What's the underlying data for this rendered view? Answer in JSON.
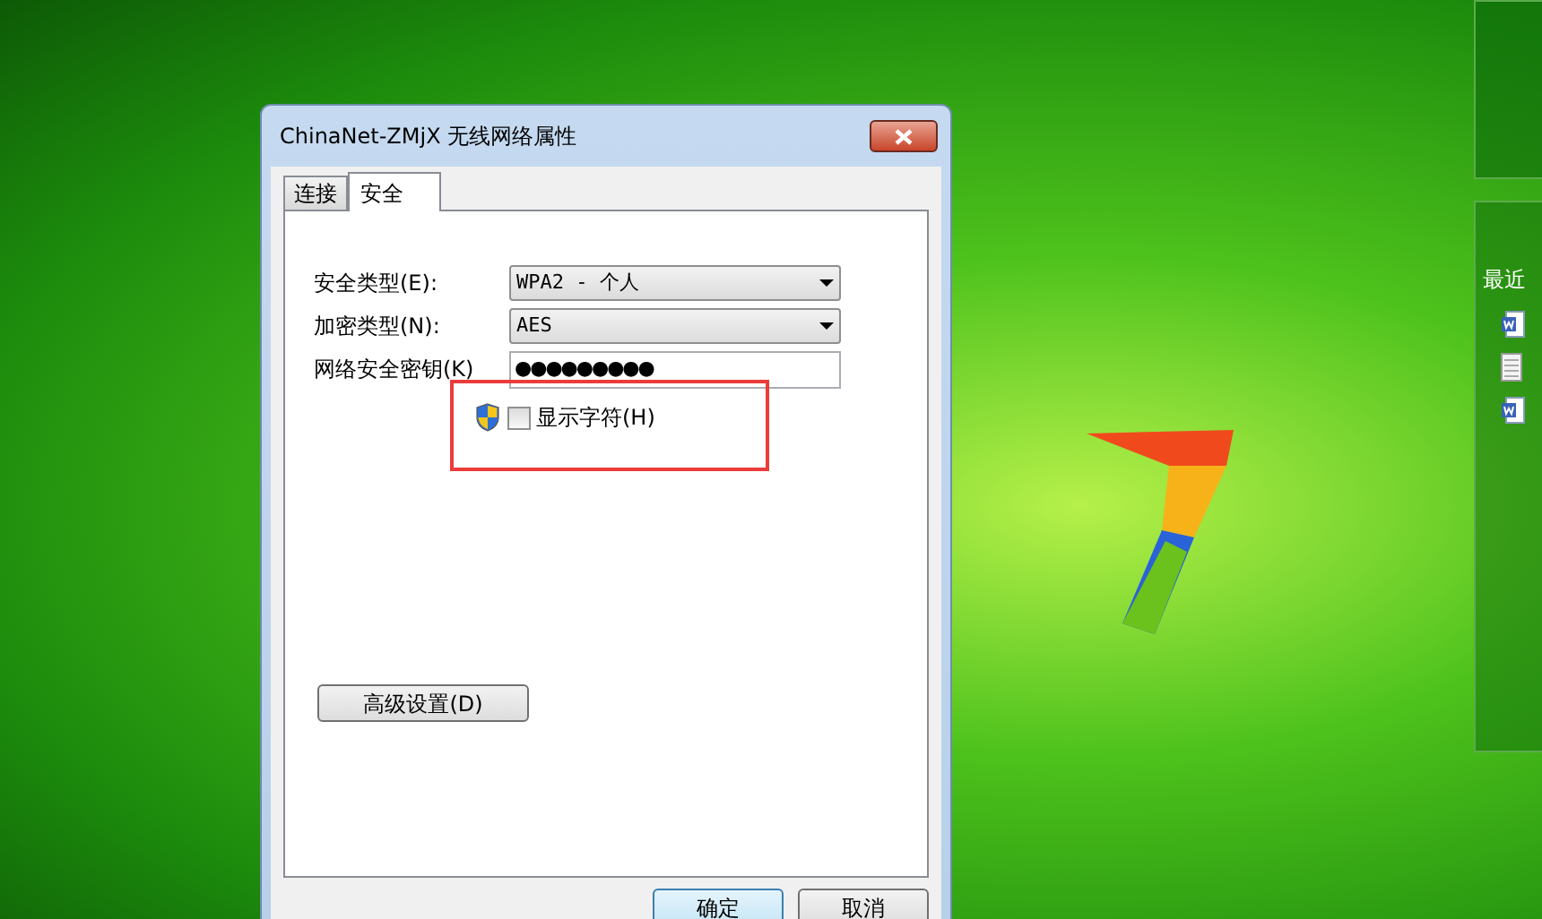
{
  "window": {
    "title": "ChinaNet-ZMjX 无线网络属性"
  },
  "tabs": [
    {
      "label": "连接",
      "selected": false
    },
    {
      "label": "安全",
      "selected": true
    }
  ],
  "fields": [
    {
      "kind": "dropdown",
      "label": "安全类型(E):",
      "value": "WPA2 - 个人"
    },
    {
      "kind": "dropdown",
      "label": "加密类型(N):",
      "value": "AES"
    },
    {
      "kind": "password",
      "label": "网络安全密钥(K)",
      "value": "●●●●●●●●●"
    }
  ],
  "show_characters": {
    "label": "显示字符(H)",
    "checked": false
  },
  "advanced_button": "高级设置(D)",
  "buttons": [
    {
      "label": "确定",
      "default": true
    },
    {
      "label": "取消",
      "default": false
    }
  ],
  "side_panel": {
    "heading": "最近",
    "items": [
      {
        "kind": "document"
      },
      {
        "kind": "note"
      },
      {
        "kind": "document"
      }
    ]
  }
}
